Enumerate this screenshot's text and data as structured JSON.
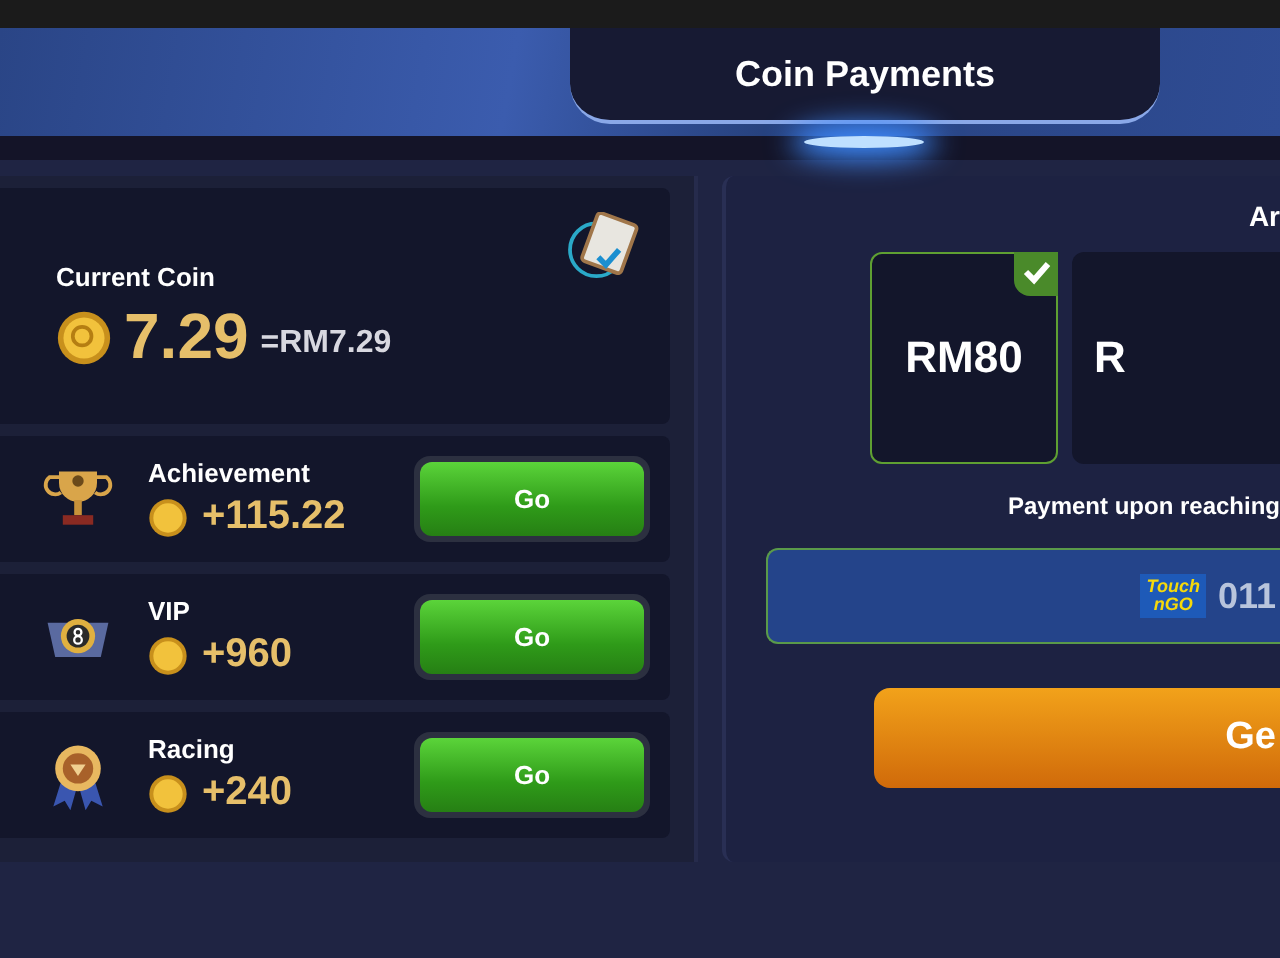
{
  "header": {
    "title": "Coin Payments"
  },
  "current": {
    "label": "Current Coin",
    "amount": "7.29",
    "equivalent": "=RM7.29"
  },
  "tasks": [
    {
      "kind": "trophy",
      "name": "Achievement",
      "reward": "+115.22",
      "button": "Go"
    },
    {
      "kind": "vip",
      "name": "VIP",
      "reward": "+960",
      "button": "Go"
    },
    {
      "kind": "medal",
      "name": "Racing",
      "reward": "+240",
      "button": "Go"
    }
  ],
  "withdraw": {
    "heading": "Ar",
    "amounts": [
      {
        "label": "RM80",
        "selected": true
      },
      {
        "label": "R",
        "selected": false
      }
    ],
    "note": "Payment upon reaching",
    "wallet": {
      "logo_lines": [
        "Touch",
        "nGO"
      ],
      "account": "011"
    },
    "button": "Ge"
  }
}
